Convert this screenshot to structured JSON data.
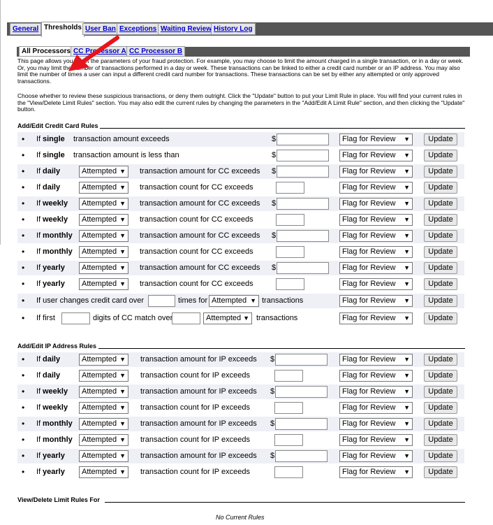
{
  "main_tabs": [
    "General",
    "Thresholds",
    "User Ban",
    "Exceptions",
    "Waiting Review",
    "History Log"
  ],
  "sub_tabs": [
    "All Processors",
    "CC Processor A",
    "CC Processor B"
  ],
  "intro": {
    "p1": "This page allows you to set the parameters of your fraud protection. For example, you may choose to limit the amount charged in a single transaction, or in a day or week. Or, you may limit the number of transactions performed in a day or week. These transactions can be linked to either a credit card number or an IP address. You may also limit the number of times a user can input a different credit card number for transactions. These transactions can be set by either any attempted or only approved transactions.",
    "p2": "Choose whether to review these suspicious transactions, or deny them outright. Click the \"Update\" button to put your Limit Rule in place. You will find your current rules in the \"View/Delete Limit Rules\" section. You may also edit the current rules by changing the parameters in the \"Add/Edit A Limit Rule\" section, and then clicking the \"Update\" button."
  },
  "cc_section": {
    "title": "Add/Edit Credit Card Rules",
    "rows": [
      {
        "if": "If",
        "period": "single",
        "text": "transaction amount exceeds"
      },
      {
        "if": "If",
        "period": "single",
        "text": "transaction amount is less than"
      },
      {
        "if": "If",
        "period": "daily",
        "select": "Attempted",
        "text": "transaction amount for CC exceeds"
      },
      {
        "if": "If",
        "period": "daily",
        "select": "Attempted",
        "text": "transaction count for CC exceeds"
      },
      {
        "if": "If",
        "period": "weekly",
        "select": "Attempted",
        "text": "transaction amount for CC exceeds"
      },
      {
        "if": "If",
        "period": "weekly",
        "select": "Attempted",
        "text": "transaction count for CC exceeds"
      },
      {
        "if": "If",
        "period": "monthly",
        "select": "Attempted",
        "text": "transaction amount for CC exceeds"
      },
      {
        "if": "If",
        "period": "monthly",
        "select": "Attempted",
        "text": "transaction count for CC exceeds"
      },
      {
        "if": "If",
        "period": "yearly",
        "select": "Attempted",
        "text": "transaction amount for CC exceeds"
      },
      {
        "if": "If",
        "period": "yearly",
        "select": "Attempted",
        "text": "transaction count for CC exceeds"
      }
    ],
    "change_row": {
      "a": "If user changes credit card over",
      "b": "times for",
      "select": "Attempted",
      "c": "transactions"
    },
    "digits_row": {
      "a": "If first",
      "b": "digits of CC match over",
      "select": "Attempted",
      "c": "transactions"
    }
  },
  "ip_section": {
    "title": "Add/Edit IP Address Rules",
    "rows": [
      {
        "if": "If",
        "period": "daily",
        "select": "Attempted",
        "text": "transaction amount for IP exceeds"
      },
      {
        "if": "If",
        "period": "daily",
        "select": "Attempted",
        "text": "transaction count for IP exceeds"
      },
      {
        "if": "If",
        "period": "weekly",
        "select": "Attempted",
        "text": "transaction amount for IP exceeds"
      },
      {
        "if": "If",
        "period": "weekly",
        "select": "Attempted",
        "text": "transaction count for IP exceeds"
      },
      {
        "if": "If",
        "period": "monthly",
        "select": "Attempted",
        "text": "transaction amount for IP exceeds"
      },
      {
        "if": "If",
        "period": "monthly",
        "select": "Attempted",
        "text": "transaction count for IP exceeds"
      },
      {
        "if": "If",
        "period": "yearly",
        "select": "Attempted",
        "text": "transaction amount for IP exceeds"
      },
      {
        "if": "If",
        "period": "yearly",
        "select": "Attempted",
        "text": "transaction count for IP exceeds"
      }
    ]
  },
  "action_select": "Flag for Review",
  "update_label": "Update",
  "currency": "$",
  "view_section": {
    "title": "View/Delete Limit Rules For",
    "empty": "No Current Rules"
  },
  "colors": {
    "bar": "#555555",
    "link": "#0000cc",
    "alt_row": "#eef0f6",
    "arrow": "#e8141b"
  }
}
